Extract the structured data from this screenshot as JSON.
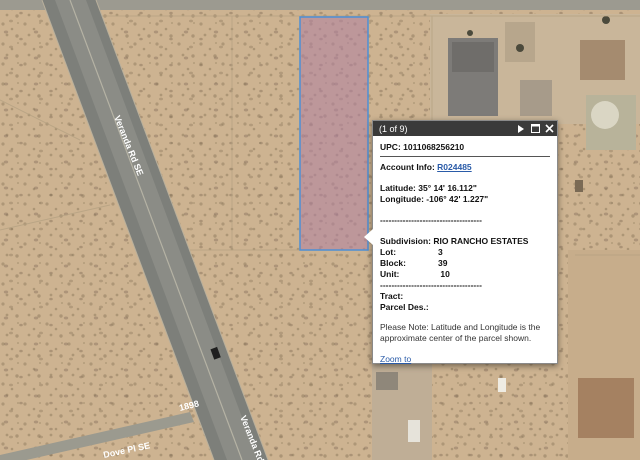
{
  "map": {
    "road_label_top": "Veranda Rd SE",
    "road_label_bottom": "Veranda Rd",
    "street_label_bottom_left": "Dove Pl SE",
    "street_number": "1898",
    "colors": {
      "ground": "#cdb391",
      "parcel_fill": "#b07fa2",
      "parcel_border": "#4d8fd6",
      "road": "#7d7f7a"
    }
  },
  "popup": {
    "page_indicator": "(1 of 9)",
    "icons": {
      "next": "next-icon",
      "maximize": "maximize-icon",
      "close": "close-icon"
    },
    "upc_label": "UPC:",
    "upc_value": "1011068256210",
    "account_label": "Account Info:",
    "account_value": "R024485",
    "latitude_label": "Latitude:",
    "latitude_value": "35° 14' 16.112\"",
    "longitude_label": "Longitude:",
    "longitude_value": "-106° 42' 1.227\"",
    "divider1": "------------------------------------",
    "subdivision_label": "Subdivision:",
    "subdivision_value": "RIO RANCHO ESTATES",
    "lot_label": "Lot:",
    "lot_value": "3",
    "block_label": "Block:",
    "block_value": "39",
    "unit_label": "Unit:",
    "unit_value": "10",
    "divider2": "------------------------------------",
    "tract_label": "Tract:",
    "parcel_des_label": "Parcel Des.:",
    "note": "Please Note: Latitude and Longitude is the approximate center of the parcel shown.",
    "zoom_link": "Zoom to"
  }
}
